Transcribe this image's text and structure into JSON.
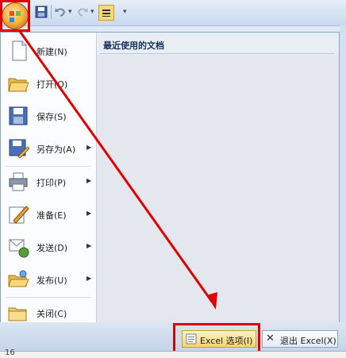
{
  "recent_title": "最近使用的文档",
  "menu_items": [
    {
      "label": "新建(N)",
      "icon": "new-document-icon",
      "submenu": false
    },
    {
      "label": "打开(O)",
      "icon": "open-folder-icon",
      "submenu": false
    },
    {
      "label": "保存(S)",
      "icon": "save-disk-icon",
      "submenu": false
    },
    {
      "label": "另存为(A)",
      "icon": "save-as-icon",
      "submenu": true
    },
    {
      "label": "打印(P)",
      "icon": "printer-icon",
      "submenu": true
    },
    {
      "label": "准备(E)",
      "icon": "prepare-pen-icon",
      "submenu": true
    },
    {
      "label": "发送(D)",
      "icon": "send-icon",
      "submenu": true
    },
    {
      "label": "发布(U)",
      "icon": "publish-icon",
      "submenu": true
    },
    {
      "label": "关闭(C)",
      "icon": "close-folder-icon",
      "submenu": false
    }
  ],
  "buttons": {
    "options": "Excel 选项(I)",
    "exit": "退出 Excel(X)"
  },
  "status_cell": "16",
  "colors": {
    "highlight": "#e00000",
    "accent": "#15335b"
  }
}
